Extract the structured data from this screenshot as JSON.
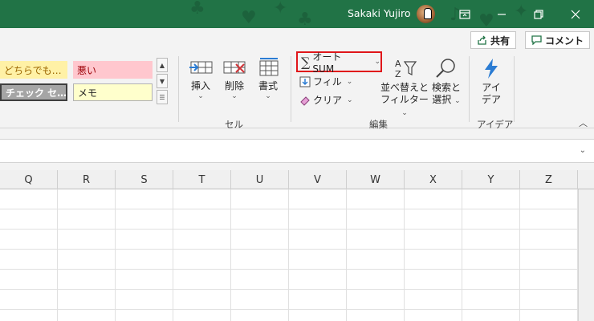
{
  "titlebar": {
    "user_name": "Sakaki Yujiro",
    "controls": [
      "ribbon-display-options",
      "minimize",
      "restore",
      "close"
    ]
  },
  "header_actions": {
    "share_label": "共有",
    "comments_label": "コメント"
  },
  "styles": {
    "cells": [
      {
        "label": "どちらでも…",
        "bg": "#fff1a6",
        "color": "#9c6500"
      },
      {
        "label": "悪い",
        "bg": "#ffc7ce",
        "color": "#9c0006"
      },
      {
        "label": "チェック セ…",
        "bg": "#a5a5a5",
        "color": "#ffffff"
      },
      {
        "label": "メモ",
        "bg": "#ffffcc",
        "color": "#222222"
      }
    ]
  },
  "cells_group": {
    "insert_label": "挿入",
    "delete_label": "削除",
    "format_label": "書式",
    "group_label": "セル"
  },
  "editing_group": {
    "autosum_label": "オート SUM",
    "fill_label": "フィル",
    "clear_label": "クリア",
    "sort_filter_label_1": "並べ替えと",
    "sort_filter_label_2": "フィルター",
    "find_select_label_1": "検索と",
    "find_select_label_2": "選択",
    "group_label": "編集"
  },
  "ideas_group": {
    "ideas_label_1": "アイ",
    "ideas_label_2": "デア",
    "group_label": "アイデア"
  },
  "columns": [
    "Q",
    "R",
    "S",
    "T",
    "U",
    "V",
    "W",
    "X",
    "Y",
    "Z"
  ],
  "colors": {
    "titlebar": "#217346",
    "highlight": "#e0161a"
  }
}
